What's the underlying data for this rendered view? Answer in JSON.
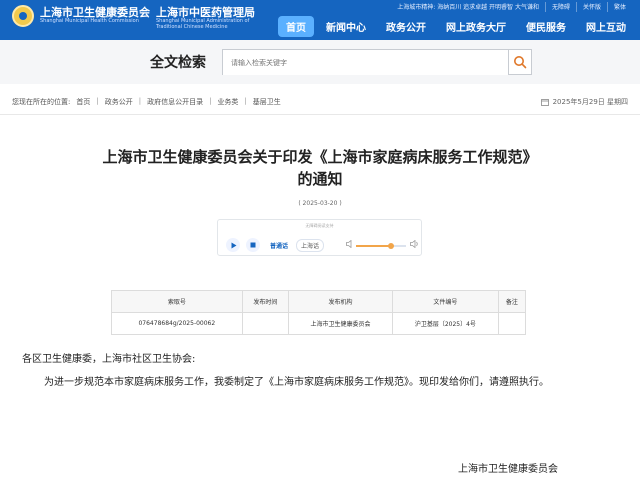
{
  "header": {
    "org1_cn": "上海市卫生健康委员会",
    "org1_en": "Shanghai Municipal Health Commission",
    "org2_cn": "上海市中医药管理局",
    "org2_en": "Shanghai Municipal Administration of Traditional Chinese Medicine",
    "top_links": [
      "上海城市精神: 海纳百川 追求卓越 开明睿智 大气谦和",
      "无障碍",
      "关怀版",
      "繁体"
    ],
    "nav": [
      {
        "label": "首页",
        "active": true
      },
      {
        "label": "新闻中心",
        "active": false
      },
      {
        "label": "政务公开",
        "active": false
      },
      {
        "label": "网上政务大厅",
        "active": false
      },
      {
        "label": "便民服务",
        "active": false
      },
      {
        "label": "网上互动",
        "active": false
      }
    ]
  },
  "search": {
    "title": "全文检索",
    "placeholder": "请输入检索关键字"
  },
  "breadcrumb": {
    "prefix": "您现在所在的位置:",
    "items": [
      "首页",
      "政务公开",
      "政府信息公开目录",
      "业务类",
      "基层卫生"
    ]
  },
  "date_line": "2025年5月29日 星期四",
  "article": {
    "title_line1": "上海市卫生健康委员会关于印发《上海市家庭病床服务工作规范》",
    "title_line2": "的通知",
    "date": "( 2025-03-20 )"
  },
  "player": {
    "label": "无障碍阅读支持",
    "voice_label": "普通话",
    "voice_tag": "上海话",
    "volume": 0.7
  },
  "meta": {
    "headers": [
      "索取号",
      "发布时间",
      "发布机构",
      "文件编号",
      "备注"
    ],
    "row": [
      "076478684g/2025-00062",
      "",
      "上海市卫生健康委员会",
      "沪卫基层〔2025〕4号",
      ""
    ]
  },
  "body": {
    "salutation": "各区卫生健康委，上海市社区卫生协会:",
    "paragraph": "为进一步规范本市家庭病床服务工作，我委制定了《上海市家庭病床服务工作规范》。现印发给你们，请遵照执行。",
    "signature": "上海市卫生健康委员会"
  },
  "colors": {
    "header_bg": "#1565c0",
    "nav_active": "#5ab0ff",
    "search_icon": "#e0782a"
  }
}
